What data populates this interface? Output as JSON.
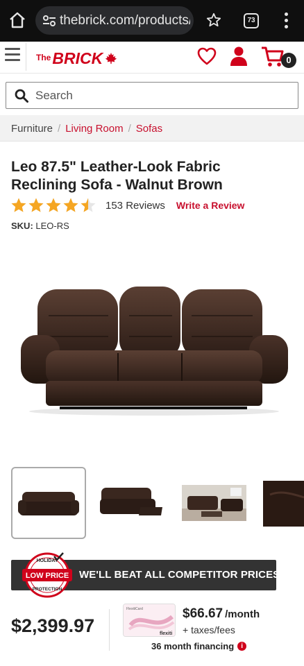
{
  "browser": {
    "url": "thebrick.com/products/l",
    "tab_count": "73"
  },
  "header": {
    "logo_the": "The",
    "logo_brick": "BRICK",
    "cart_count": "0"
  },
  "search": {
    "placeholder": "Search"
  },
  "breadcrumb": {
    "items": [
      "Furniture",
      "Living Room",
      "Sofas"
    ],
    "separator": "/"
  },
  "product": {
    "title": "Leo 87.5\" Leather-Look Fabric Reclining Sofa - Walnut Brown",
    "rating": 4.5,
    "rating_max": 5,
    "review_count": "153 Reviews",
    "write_review": "Write a Review",
    "sku_label": "SKU:",
    "sku_value": "LEO-RS"
  },
  "promo": {
    "beat_text": "WE'LL BEAT ALL COMPETITOR PRICES!",
    "seal_top": "HOLIDAY",
    "seal_middle": "LOW PRICE",
    "seal_bottom": "PROTECTION"
  },
  "pricing": {
    "price": "$2,399.97",
    "monthly_amount": "$66.67",
    "monthly_unit": "/month",
    "taxes": "+ taxes/fees",
    "financing": "36 month financing",
    "card_brand": "flexiti",
    "card_label": "FlexitiCard"
  },
  "colors": {
    "brand_red": "#d0021b",
    "link_red": "#c8102e",
    "star_yellow": "#f5a623",
    "banner_dark": "#333333",
    "browser_bar": "#0f0f0f"
  }
}
